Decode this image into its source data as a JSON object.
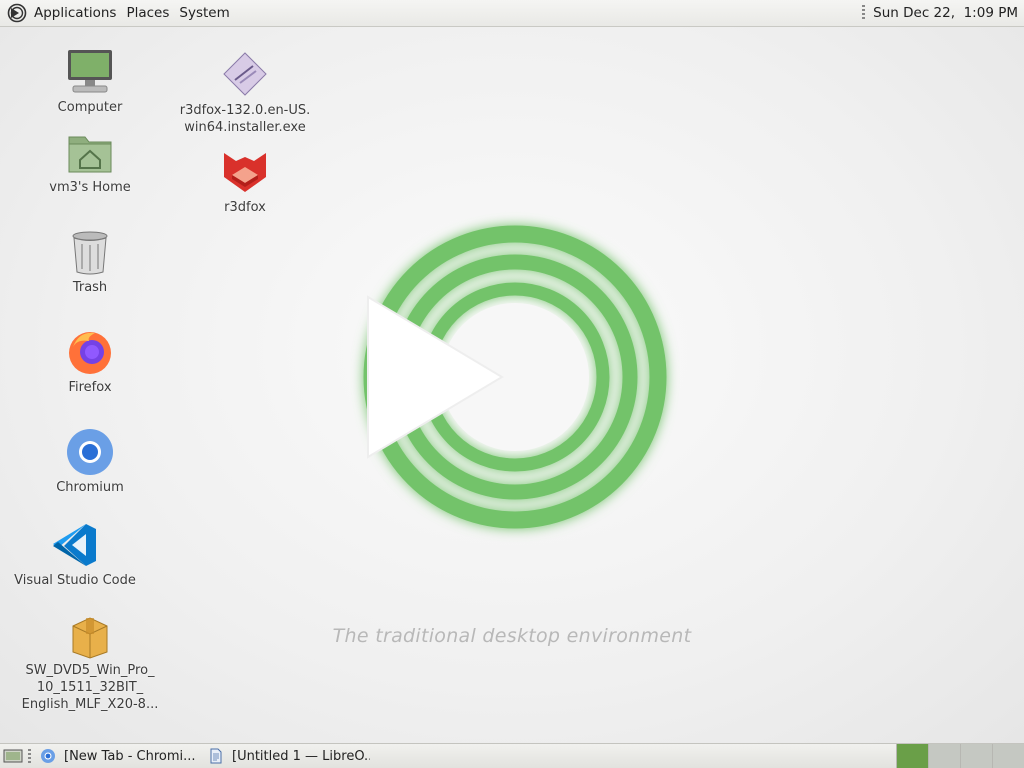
{
  "top_panel": {
    "menus": [
      "Applications",
      "Places",
      "System"
    ],
    "clock": "Sun Dec 22,  1:09 PM"
  },
  "desktop": {
    "icons_left": [
      {
        "label": "Computer",
        "icon": "computer-icon"
      },
      {
        "label": "vm3's Home",
        "icon": "home-folder-icon"
      },
      {
        "label": "Trash",
        "icon": "trash-icon"
      },
      {
        "label": "Firefox",
        "icon": "firefox-icon"
      },
      {
        "label": "Chromium",
        "icon": "chromium-icon"
      },
      {
        "label": "Visual Studio Code",
        "icon": "vscode-icon"
      },
      {
        "label": "SW_DVD5_Win_Pro_\n10_1511_32BIT_\nEnglish_MLF_X20-8...",
        "icon": "archive-package-icon"
      }
    ],
    "icons_right": [
      {
        "label": "r3dfox-132.0.en-US.\nwin64.installer.exe",
        "icon": "installer-exe-icon"
      },
      {
        "label": "r3dfox",
        "icon": "r3dfox-icon"
      }
    ],
    "tagline": "The traditional desktop environment",
    "accent_color": "#73c36b"
  },
  "bottom_panel": {
    "tasks": [
      {
        "label": "[New Tab - Chromi...",
        "icon": "chromium-icon"
      },
      {
        "label": "[Untitled 1 — LibreO...",
        "icon": "libreoffice-writer-icon"
      }
    ],
    "workspaces": 4,
    "active_workspace": 1
  }
}
